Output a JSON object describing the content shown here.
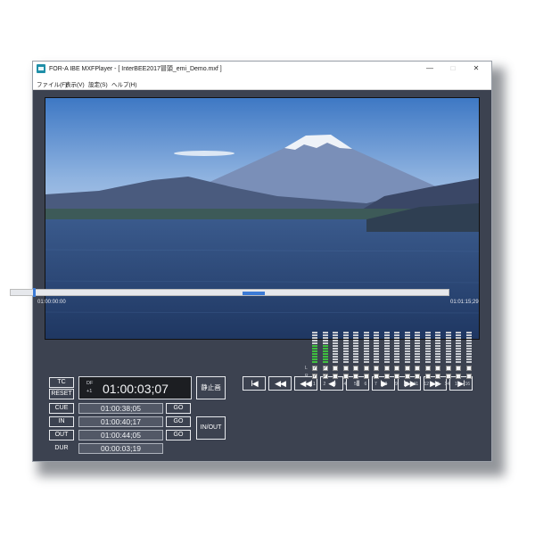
{
  "window": {
    "title": "FOR-A IBE MXFPlayer - [ InterBEE2017冒頭_emi_Demo.mxf ]",
    "controls": {
      "minimize": "—",
      "maximize": "□",
      "close": "✕"
    }
  },
  "menu": [
    {
      "label": "ファイル(F)"
    },
    {
      "label": "表示(V)"
    },
    {
      "label": "設定(S)"
    },
    {
      "label": "ヘルプ(H)"
    }
  ],
  "seek": {
    "start_time": "01:00:00:00",
    "end_time": "01:01:15;29",
    "position": 0.05,
    "mark_in": 0.53,
    "mark_out": 0.58
  },
  "timecode": {
    "df": "DF",
    "field": "+1",
    "current": "01:00:03;07"
  },
  "buttons": {
    "tc": "TC",
    "reset": "RESET",
    "cue": "CUE",
    "in": "IN",
    "out": "OUT",
    "dur": "DUR",
    "go": "GO",
    "still": "静止画",
    "inout": "IN/OUT"
  },
  "values": {
    "cue": "01:00:38;05",
    "in": "01:00:40;17",
    "out": "01:00:44;05",
    "dur": "00:00:03;19"
  },
  "transport": [
    {
      "name": "go-to-start",
      "glyph": "I◀"
    },
    {
      "name": "fast-rewind",
      "glyph": "◀◀"
    },
    {
      "name": "rewind",
      "glyph": "◀◀I"
    },
    {
      "name": "step-back",
      "glyph": "◀I"
    },
    {
      "name": "pause",
      "glyph": "II"
    },
    {
      "name": "step-forward",
      "glyph": "I▶"
    },
    {
      "name": "play",
      "glyph": "I▶▶"
    },
    {
      "name": "fast-forward",
      "glyph": "▶▶"
    },
    {
      "name": "go-to-end",
      "glyph": "▶I"
    }
  ],
  "audio": {
    "channels": [
      "1",
      "2",
      "3",
      "4",
      "5",
      "6",
      "7",
      "8",
      "9",
      "10",
      "11",
      "12",
      "13",
      "14",
      "15",
      "16"
    ],
    "levels": [
      0.55,
      0.55,
      0,
      0,
      0,
      0,
      0,
      0,
      0,
      0,
      0,
      0,
      0,
      0,
      0,
      0
    ],
    "row_labels": {
      "left": "L",
      "right": "R"
    },
    "checked": [
      true,
      true,
      false,
      false,
      false,
      false,
      false,
      false,
      false,
      false,
      false,
      false,
      false,
      false,
      false,
      false
    ]
  }
}
